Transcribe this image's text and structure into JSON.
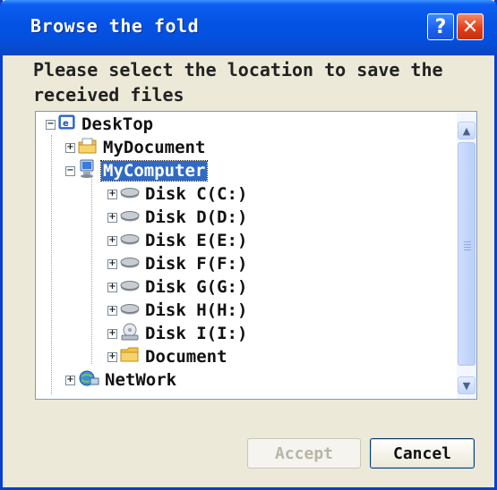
{
  "window": {
    "title": "Browse the fold",
    "help_label": "?",
    "close_label": "✕"
  },
  "prompt": "Please select the location to save the received files",
  "tree": {
    "root": {
      "label": "DeskTop",
      "icon": "desktop-icon",
      "expander": "−"
    },
    "items": [
      {
        "label": "MyDocument",
        "icon": "folder-documents-icon",
        "expander": "+"
      },
      {
        "label": "MyComputer",
        "icon": "computer-icon",
        "expander": "−",
        "selected": true
      },
      {
        "label": "Disk C(C:)",
        "icon": "hard-disk-icon",
        "expander": "+"
      },
      {
        "label": "Disk D(D:)",
        "icon": "hard-disk-icon",
        "expander": "+"
      },
      {
        "label": "Disk E(E:)",
        "icon": "hard-disk-icon",
        "expander": "+"
      },
      {
        "label": "Disk F(F:)",
        "icon": "hard-disk-icon",
        "expander": "+"
      },
      {
        "label": "Disk G(G:)",
        "icon": "hard-disk-icon",
        "expander": "+"
      },
      {
        "label": "Disk H(H:)",
        "icon": "hard-disk-icon",
        "expander": "+"
      },
      {
        "label": "Disk I(I:)",
        "icon": "cd-drive-icon",
        "expander": "+"
      },
      {
        "label": "Document",
        "icon": "folder-icon",
        "expander": "+"
      },
      {
        "label": "NetWork",
        "icon": "network-icon",
        "expander": "+"
      }
    ]
  },
  "scrollbar": {
    "up": "▲",
    "down": "▼"
  },
  "buttons": {
    "accept": "Accept",
    "cancel": "Cancel"
  },
  "colors": {
    "title_bar": "#0453e4",
    "selection": "#316ac5"
  }
}
